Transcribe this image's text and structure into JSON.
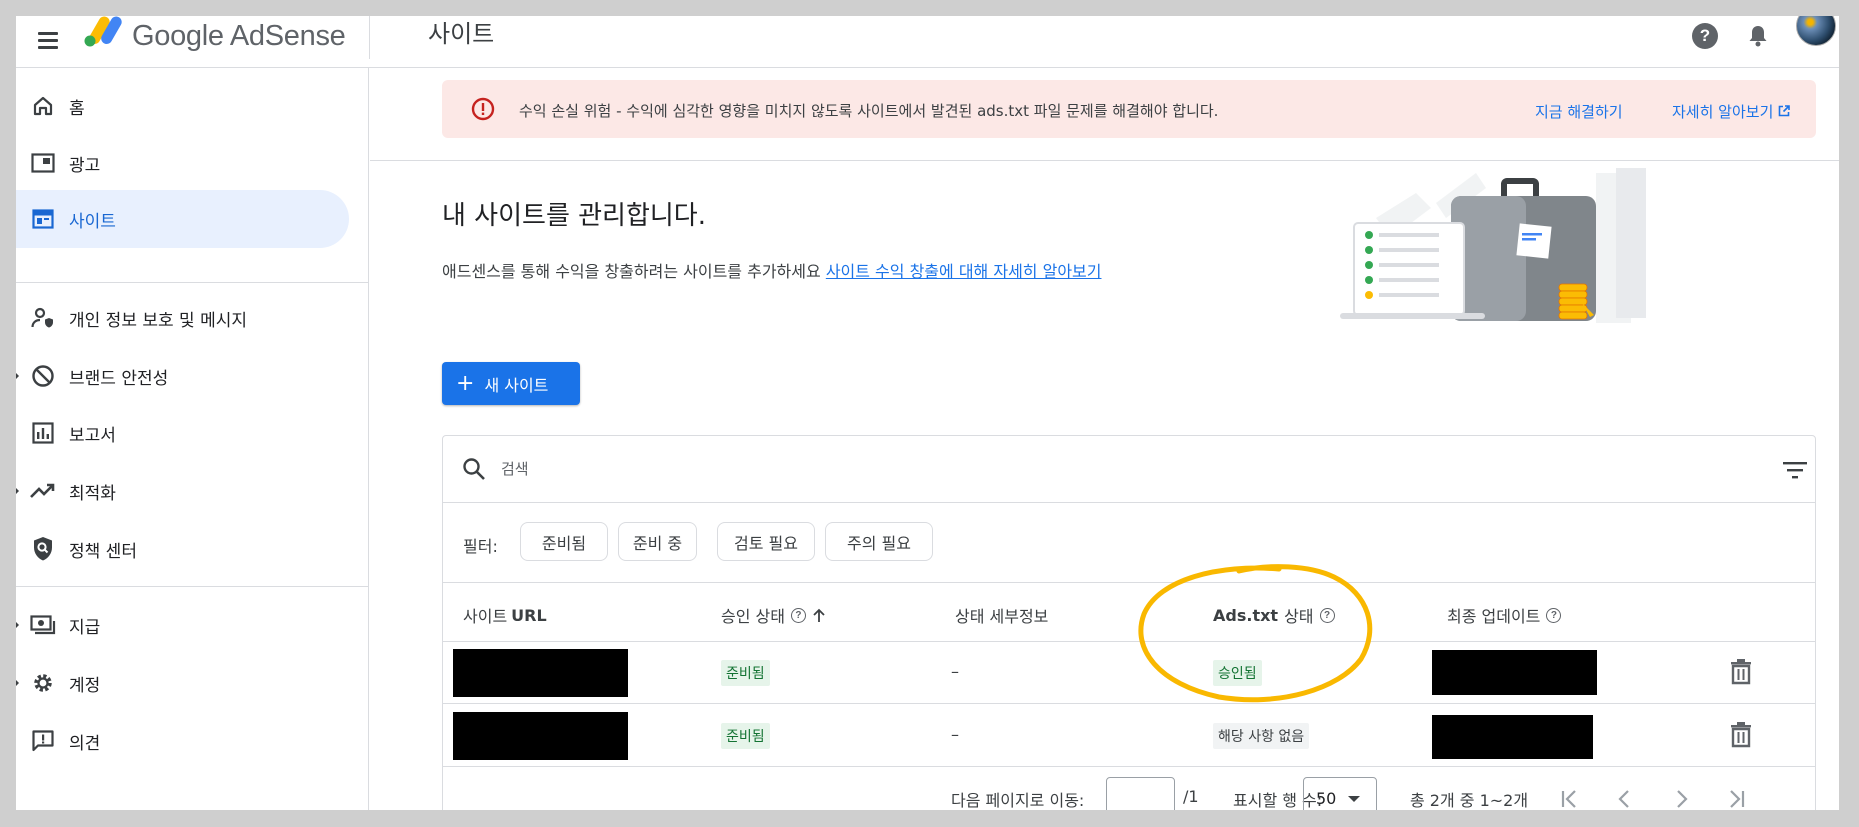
{
  "app": {
    "brand": "Google AdSense",
    "page_title": "사이트"
  },
  "colors": {
    "accent": "#1a73e8",
    "alert_bg": "#fce8e6",
    "alert_icon": "#c5221f",
    "status_green": "#137333",
    "annotation": "#f9b800"
  },
  "sidebar": {
    "items": [
      {
        "label": "홈",
        "icon": "home-icon"
      },
      {
        "label": "광고",
        "icon": "ads-icon"
      },
      {
        "label": "사이트",
        "icon": "sites-icon",
        "active": true
      },
      {
        "label": "개인 정보 보호 및 메시지",
        "icon": "privacy-messaging-icon"
      },
      {
        "label": "브랜드 안전성",
        "icon": "block-icon"
      },
      {
        "label": "보고서",
        "icon": "reports-icon"
      },
      {
        "label": "최적화",
        "icon": "trending-icon"
      },
      {
        "label": "정책 센터",
        "icon": "policy-shield-icon"
      },
      {
        "label": "지급",
        "icon": "payments-icon"
      },
      {
        "label": "계정",
        "icon": "settings-icon"
      },
      {
        "label": "의견",
        "icon": "feedback-icon"
      }
    ]
  },
  "alert": {
    "text": "수익 손실 위험 - 수익에 심각한 영향을 미치지 않도록 사이트에서 발견된 ads.txt 파일 문제를 해결해야 합니다.",
    "fix_link": "지금 해결하기",
    "learn_link": "자세히 알아보기"
  },
  "header": {
    "title": "내 사이트를 관리합니다.",
    "subtitle": "애드센스를 통해 수익을 창출하려는 사이트를 추가하세요",
    "subtitle_link": "사이트 수익 창출에 대해 자세히 알아보기"
  },
  "new_site_button": "새 사이트",
  "search": {
    "placeholder": "검색"
  },
  "filters": {
    "label": "필터:",
    "chips": [
      "준비됨",
      "준비 중",
      "검토 필요",
      "주의 필요"
    ]
  },
  "table": {
    "columns": {
      "site_url_prefix": "사이트",
      "site_url_bold": "URL",
      "approval": "승인 상태",
      "details": "상태 세부정보",
      "adstxt_bold": "Ads.txt",
      "adstxt_suffix": "상태",
      "updated": "최종 업데이트"
    },
    "rows": [
      {
        "approval": "준비됨",
        "details": "–",
        "adstxt": "승인됨"
      },
      {
        "approval": "준비됨",
        "details": "–",
        "adstxt": "해당 사항 없음"
      }
    ]
  },
  "pager": {
    "goto_label": "다음 페이지로 이동:",
    "total_pages": "/1",
    "rows_label": "표시할 행 수:",
    "rows_value": "50",
    "range": "총 2개 중 1~2개"
  }
}
